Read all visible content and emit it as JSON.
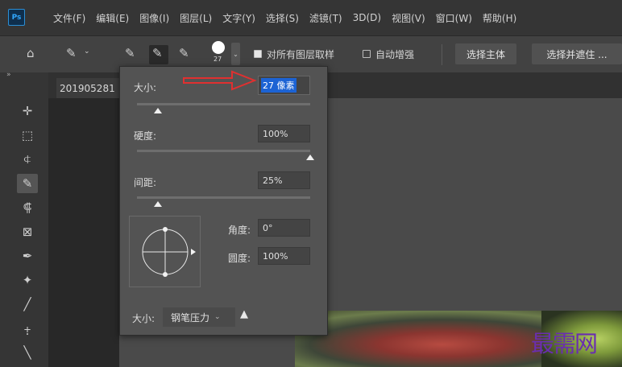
{
  "app": {
    "logo_text": "Ps"
  },
  "menubar": {
    "items": [
      "文件(F)",
      "编辑(E)",
      "图像(I)",
      "图层(L)",
      "文字(Y)",
      "选择(S)",
      "滤镜(T)",
      "3D(D)",
      "视图(V)",
      "窗口(W)",
      "帮助(H)"
    ]
  },
  "options_bar": {
    "brush_size_preview": "27",
    "sample_all_layers_label": "对所有图层取样",
    "sample_all_layers_checked": true,
    "auto_enhance_label": "自动增强",
    "auto_enhance_checked": false,
    "select_subject_label": "选择主体",
    "select_and_mask_label": "选择并遮住 ..."
  },
  "document": {
    "tab_title": "201905281"
  },
  "brush_panel": {
    "size_label": "大小:",
    "size_value": "27 像素",
    "size_slider_fraction": 0.12,
    "hardness_label": "硬度:",
    "hardness_value": "100%",
    "hardness_slider_fraction": 1.0,
    "spacing_label": "间距:",
    "spacing_value": "25%",
    "spacing_slider_fraction": 0.12,
    "angle_label": "角度:",
    "angle_value": "0°",
    "roundness_label": "圆度:",
    "roundness_value": "100%",
    "pressure_label": "大小:",
    "pressure_value": "钢笔压力"
  },
  "colors": {
    "accent_arrow": "#e03030",
    "selection_highlight": "#1c63d4",
    "watermark": "#6a2eb0"
  },
  "watermark": {
    "text": "最需网"
  }
}
